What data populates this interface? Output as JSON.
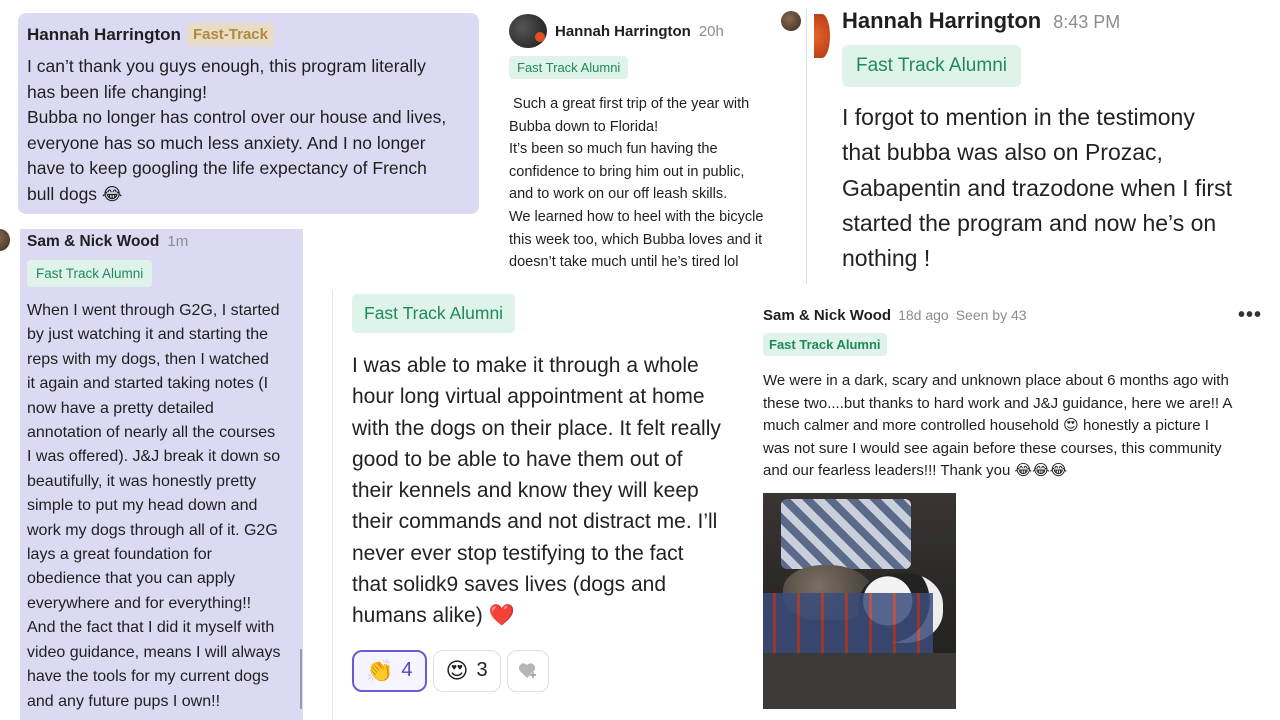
{
  "card1": {
    "author": "Hannah Harrington",
    "badge": "Fast-Track",
    "text": "I can’t thank you guys enough, this program literally\nhas been life changing!\nBubba no longer has control over our house and lives,\neveryone has so much less anxiety. And I no longer\nhave to keep googling the life expectancy of French\nbull dogs 😂"
  },
  "card2": {
    "author": "Hannah Harrington",
    "time": "20h",
    "badge": "Fast Track Alumni",
    "text": " Such a great first trip of the year with\nBubba down to Florida!\nIt’s been so much fun having the\nconfidence to bring him out in public,\nand to work on our off leash skills.\nWe learned how to heel with the bicycle\nthis week too, which Bubba loves and it\ndoesn’t take much until he’s tired lol"
  },
  "card3": {
    "author": "Hannah Harrington",
    "time": "8:43 PM",
    "badge": "Fast Track Alumni",
    "text": "I forgot to mention in the testimony\nthat bubba was also on Prozac,\nGabapentin and trazodone when I first\nstarted the program and now he’s on\nnothing !"
  },
  "card4": {
    "author": "Sam & Nick Wood",
    "time": "1m",
    "badge": "Fast Track Alumni",
    "text": "When I went through G2G, I started\nby just watching it and starting the\nreps with my dogs, then I watched\nit again and started taking notes (I\nnow have a pretty detailed\nannotation of nearly all the courses\nI was offered). J&J break it down so\nbeautifully, it was honestly pretty\nsimple to put my head down and\nwork my dogs through all of it. G2G\nlays a great foundation for\nobedience that you can apply\neverywhere and for everything!!\nAnd the fact that I did it myself with\nvideo guidance, means I will always\nhave the tools for my current dogs\nand any future pups I own!!"
  },
  "card5": {
    "badge": "Fast Track Alumni",
    "text": "I was able to make it through a whole\nhour long virtual appointment at home\nwith the dogs on their place. It felt really\ngood to be able to have them out of\ntheir kennels and know they will keep\ntheir commands and not distract me. I’ll\nnever ever stop testifying to the fact\nthat solidk9 saves lives (dogs and\nhumans alike) ❤️",
    "reactions": [
      {
        "emoji": "👏",
        "count": "4"
      },
      {
        "emoji": "😍",
        "count": "3"
      }
    ],
    "add_reaction_icon": "add-reaction-icon"
  },
  "card6": {
    "author": "Sam & Nick Wood",
    "time": "18d ago",
    "seen": "Seen by 43",
    "more": "•••",
    "badge": "Fast Track Alumni",
    "text": "We were in a dark, scary and unknown place about 6 months ago with\nthese two....but thanks to hard work and J&J guidance, here we are!! A\nmuch calmer and more controlled household 😍 honestly a picture I\nwas not sure I would see again before these courses, this community\nand our fearless leaders!!! Thank you 😂😂😂"
  },
  "colors": {
    "lavender": "#dcdaf3",
    "badge_green_bg": "#dff3ea",
    "badge_green_text": "#1e8a5a",
    "fasttrack_bg": "#e9dcc6",
    "fasttrack_text": "#b0893f",
    "reaction_active": "#6a5ad6"
  }
}
